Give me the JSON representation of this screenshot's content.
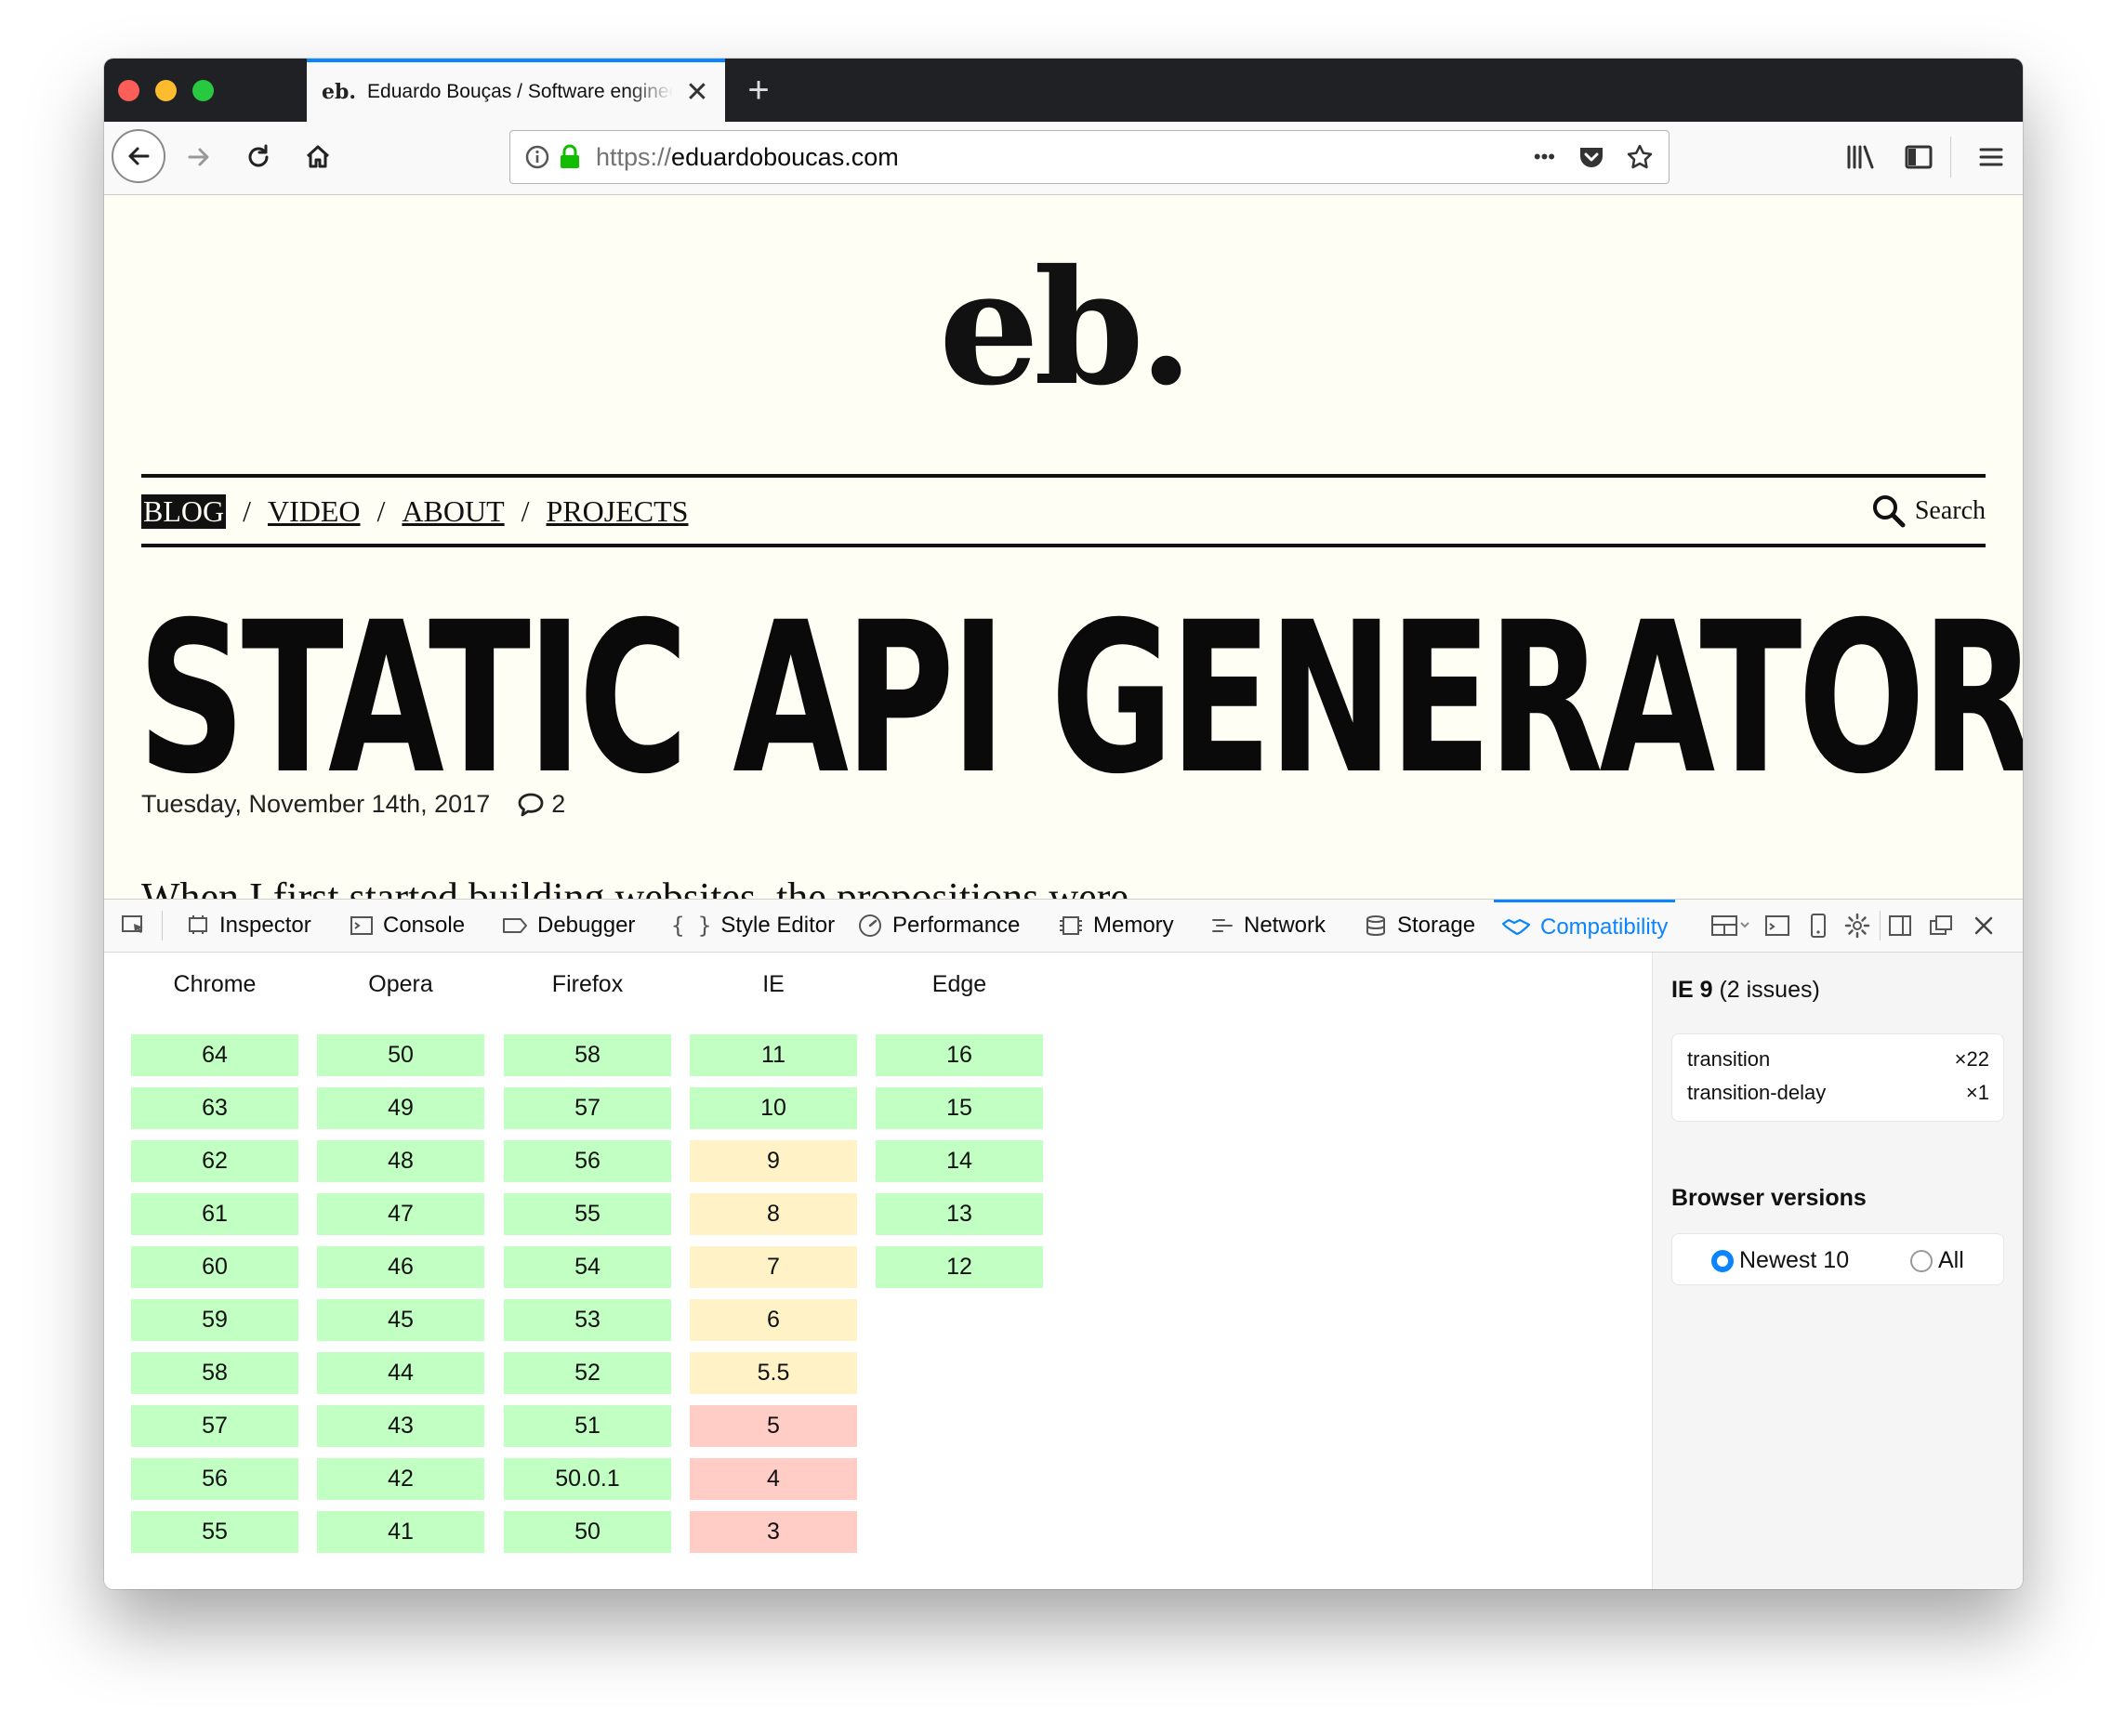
{
  "browser": {
    "tab_favicon": "eb.",
    "tab_title": "Eduardo Bouças / Software engineer",
    "tab_close": "✕",
    "new_tab": "+",
    "url_scheme": "https://",
    "url_host": "eduardoboucas.com",
    "page_actions": "•••",
    "icons": [
      "back-icon",
      "forward-icon",
      "reload-icon",
      "home-icon",
      "info-icon",
      "lock-icon",
      "pocket-icon",
      "star-icon",
      "library-icon",
      "sidebar-icon",
      "menu-icon"
    ]
  },
  "page": {
    "logo": "eb.",
    "nav": {
      "blog": "BLOG",
      "video": "VIDEO",
      "about": "ABOUT",
      "projects": "PROJECTS",
      "separator": "/"
    },
    "search_label": "Search",
    "headline": "STATIC API GENERATOR",
    "date": "Tuesday, November 14th, 2017",
    "comment_count": "2",
    "body_start": "When I first started building websites, the propositions were"
  },
  "devtools": {
    "tabs": {
      "inspector": "Inspector",
      "console": "Console",
      "debugger": "Debugger",
      "style_editor": "Style Editor",
      "performance": "Performance",
      "memory": "Memory",
      "network": "Network",
      "storage": "Storage",
      "compatibility": "Compatibility"
    },
    "accent": "#0a84ff",
    "browsers": {
      "chrome": {
        "name": "Chrome",
        "versions": [
          "64",
          "63",
          "62",
          "61",
          "60",
          "59",
          "58",
          "57",
          "56",
          "55"
        ],
        "status": [
          "ok",
          "ok",
          "ok",
          "ok",
          "ok",
          "ok",
          "ok",
          "ok",
          "ok",
          "ok"
        ]
      },
      "opera": {
        "name": "Opera",
        "versions": [
          "50",
          "49",
          "48",
          "47",
          "46",
          "45",
          "44",
          "43",
          "42",
          "41"
        ],
        "status": [
          "ok",
          "ok",
          "ok",
          "ok",
          "ok",
          "ok",
          "ok",
          "ok",
          "ok",
          "ok"
        ]
      },
      "firefox": {
        "name": "Firefox",
        "versions": [
          "58",
          "57",
          "56",
          "55",
          "54",
          "53",
          "52",
          "51",
          "50.0.1",
          "50"
        ],
        "status": [
          "ok",
          "ok",
          "ok",
          "ok",
          "ok",
          "ok",
          "ok",
          "ok",
          "ok",
          "ok"
        ]
      },
      "ie": {
        "name": "IE",
        "versions": [
          "11",
          "10",
          "9",
          "8",
          "7",
          "6",
          "5.5",
          "5",
          "4",
          "3"
        ],
        "status": [
          "ok",
          "ok",
          "partial",
          "partial",
          "partial",
          "partial",
          "partial",
          "bad",
          "bad",
          "bad"
        ]
      },
      "edge": {
        "name": "Edge",
        "versions": [
          "16",
          "15",
          "14",
          "13",
          "12"
        ],
        "status": [
          "ok",
          "ok",
          "ok",
          "ok",
          "ok"
        ]
      }
    },
    "status_colors": {
      "ok": "#c2ffc2",
      "partial": "#fff2c6",
      "bad": "#ffcdc5"
    },
    "sidebar": {
      "selected_browser": "IE 9",
      "issues_count": "(2 issues)",
      "issues": [
        {
          "property": "transition",
          "count": "×22"
        },
        {
          "property": "transition-delay",
          "count": "×1"
        }
      ],
      "versions_title": "Browser versions",
      "option_newest": "Newest 10",
      "option_all": "All",
      "selected_option": "Newest 10"
    }
  }
}
